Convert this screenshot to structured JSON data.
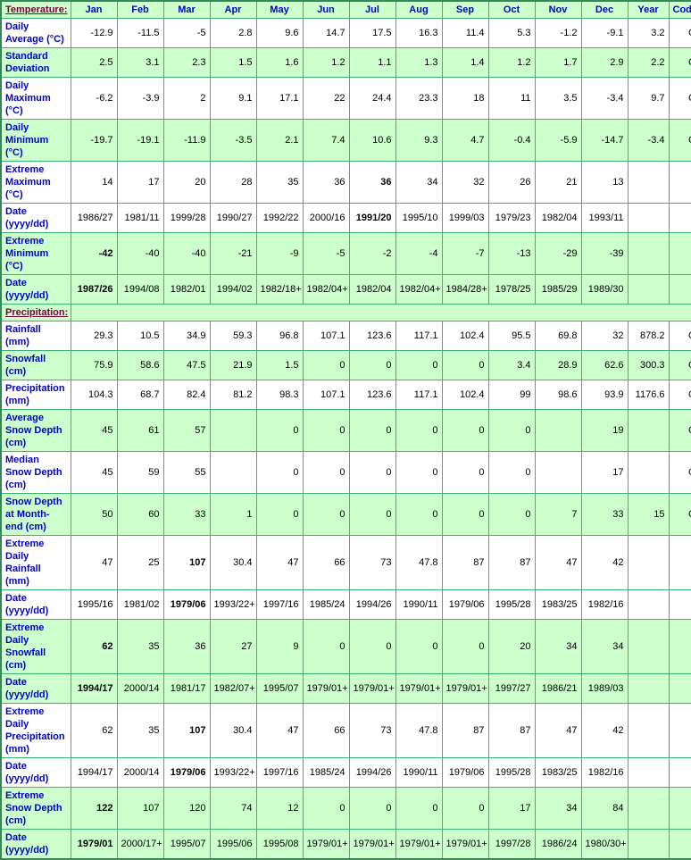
{
  "table": {
    "columns": [
      "Jan",
      "Feb",
      "Mar",
      "Apr",
      "May",
      "Jun",
      "Jul",
      "Aug",
      "Sep",
      "Oct",
      "Nov",
      "Dec",
      "Year",
      "Code"
    ],
    "sections": [
      {
        "id": "temperature",
        "title": "Temperature:",
        "rows": [
          {
            "label": "Daily Average (°C)",
            "shade": "plain",
            "cells": [
              "-12.9",
              "-11.5",
              "-5",
              "2.8",
              "9.6",
              "14.7",
              "17.5",
              "16.3",
              "11.4",
              "5.3",
              "-1.2",
              "-9.1",
              "3.2",
              "C"
            ],
            "bold": []
          },
          {
            "label": "Standard Deviation",
            "shade": "alt",
            "cells": [
              "2.5",
              "3.1",
              "2.3",
              "1.5",
              "1.6",
              "1.2",
              "1.1",
              "1.3",
              "1.4",
              "1.2",
              "1.7",
              "2.9",
              "2.2",
              "C"
            ],
            "bold": []
          },
          {
            "label": "Daily Maximum (°C)",
            "shade": "plain",
            "cells": [
              "-6.2",
              "-3.9",
              "2",
              "9.1",
              "17.1",
              "22",
              "24.4",
              "23.3",
              "18",
              "11",
              "3.5",
              "-3.4",
              "9.7",
              "C"
            ],
            "bold": []
          },
          {
            "label": "Daily Minimum (°C)",
            "shade": "alt",
            "cells": [
              "-19.7",
              "-19.1",
              "-11.9",
              "-3.5",
              "2.1",
              "7.4",
              "10.6",
              "9.3",
              "4.7",
              "-0.4",
              "-5.9",
              "-14.7",
              "-3.4",
              "C"
            ],
            "bold": []
          },
          {
            "label": "Extreme Maximum (°C)",
            "shade": "plain",
            "cells": [
              "14",
              "17",
              "20",
              "28",
              "35",
              "36",
              "36",
              "34",
              "32",
              "26",
              "21",
              "13",
              "",
              ""
            ],
            "bold": [
              6
            ]
          },
          {
            "label": "Date (yyyy/dd)",
            "shade": "plain",
            "cells": [
              "1986/27",
              "1981/11",
              "1999/28",
              "1990/27",
              "1992/22",
              "2000/16",
              "1991/20",
              "1995/10",
              "1999/03",
              "1979/23",
              "1982/04",
              "1993/11",
              "",
              ""
            ],
            "bold": [
              6
            ]
          },
          {
            "label": "Extreme Minimum (°C)",
            "shade": "alt",
            "cells": [
              "-42",
              "-40",
              "-40",
              "-21",
              "-9",
              "-5",
              "-2",
              "-4",
              "-7",
              "-13",
              "-29",
              "-39",
              "",
              ""
            ],
            "bold": [
              0
            ]
          },
          {
            "label": "Date (yyyy/dd)",
            "shade": "alt",
            "cells": [
              "1987/26",
              "1994/08",
              "1982/01",
              "1994/02",
              "1982/18+",
              "1982/04+",
              "1982/04",
              "1982/04+",
              "1984/28+",
              "1978/25",
              "1985/29",
              "1989/30",
              "",
              ""
            ],
            "bold": [
              0
            ]
          }
        ]
      },
      {
        "id": "precipitation",
        "title": "Precipitation:",
        "rows": [
          {
            "label": "Rainfall (mm)",
            "shade": "plain",
            "cells": [
              "29.3",
              "10.5",
              "34.9",
              "59.3",
              "96.8",
              "107.1",
              "123.6",
              "117.1",
              "102.4",
              "95.5",
              "69.8",
              "32",
              "878.2",
              "C"
            ],
            "bold": []
          },
          {
            "label": "Snowfall (cm)",
            "shade": "alt",
            "cells": [
              "75.9",
              "58.6",
              "47.5",
              "21.9",
              "1.5",
              "0",
              "0",
              "0",
              "0",
              "3.4",
              "28.9",
              "62.6",
              "300.3",
              "C"
            ],
            "bold": []
          },
          {
            "label": "Precipitation (mm)",
            "shade": "plain",
            "cells": [
              "104.3",
              "68.7",
              "82.4",
              "81.2",
              "98.3",
              "107.1",
              "123.6",
              "117.1",
              "102.4",
              "99",
              "98.6",
              "93.9",
              "1176.6",
              "C"
            ],
            "bold": []
          },
          {
            "label": "Average Snow Depth (cm)",
            "shade": "alt",
            "cells": [
              "45",
              "61",
              "57",
              "",
              "0",
              "0",
              "0",
              "0",
              "0",
              "0",
              "",
              "19",
              "",
              "C"
            ],
            "bold": []
          },
          {
            "label": "Median Snow Depth (cm)",
            "shade": "plain",
            "cells": [
              "45",
              "59",
              "55",
              "",
              "0",
              "0",
              "0",
              "0",
              "0",
              "0",
              "",
              "17",
              "",
              "C"
            ],
            "bold": []
          },
          {
            "label": "Snow Depth at Month-end (cm)",
            "shade": "alt",
            "cells": [
              "50",
              "60",
              "33",
              "1",
              "0",
              "0",
              "0",
              "0",
              "0",
              "0",
              "7",
              "33",
              "15",
              "C"
            ],
            "bold": []
          },
          {
            "label": "Extreme Daily Rainfall (mm)",
            "shade": "plain",
            "cells": [
              "47",
              "25",
              "107",
              "30.4",
              "47",
              "66",
              "73",
              "47.8",
              "87",
              "87",
              "47",
              "42",
              "",
              ""
            ],
            "bold": [
              2
            ]
          },
          {
            "label": "Date (yyyy/dd)",
            "shade": "plain",
            "cells": [
              "1995/16",
              "1981/02",
              "1979/06",
              "1993/22+",
              "1997/16",
              "1985/24",
              "1994/26",
              "1990/11",
              "1979/06",
              "1995/28",
              "1983/25",
              "1982/16",
              "",
              ""
            ],
            "bold": [
              2
            ]
          },
          {
            "label": "Extreme Daily Snowfall (cm)",
            "shade": "alt",
            "cells": [
              "62",
              "35",
              "36",
              "27",
              "9",
              "0",
              "0",
              "0",
              "0",
              "20",
              "34",
              "34",
              "",
              ""
            ],
            "bold": [
              0
            ]
          },
          {
            "label": "Date (yyyy/dd)",
            "shade": "alt",
            "cells": [
              "1994/17",
              "2000/14",
              "1981/17",
              "1982/07+",
              "1995/07",
              "1979/01+",
              "1979/01+",
              "1979/01+",
              "1979/01+",
              "1997/27",
              "1986/21",
              "1989/03",
              "",
              ""
            ],
            "bold": [
              0
            ]
          },
          {
            "label": "Extreme Daily Precipitation (mm)",
            "shade": "plain",
            "cells": [
              "62",
              "35",
              "107",
              "30.4",
              "47",
              "66",
              "73",
              "47.8",
              "87",
              "87",
              "47",
              "42",
              "",
              ""
            ],
            "bold": [
              2
            ]
          },
          {
            "label": "Date (yyyy/dd)",
            "shade": "plain",
            "cells": [
              "1994/17",
              "2000/14",
              "1979/06",
              "1993/22+",
              "1997/16",
              "1985/24",
              "1994/26",
              "1990/11",
              "1979/06",
              "1995/28",
              "1983/25",
              "1982/16",
              "",
              ""
            ],
            "bold": [
              2
            ]
          },
          {
            "label": "Extreme Snow Depth (cm)",
            "shade": "alt",
            "cells": [
              "122",
              "107",
              "120",
              "74",
              "12",
              "0",
              "0",
              "0",
              "0",
              "17",
              "34",
              "84",
              "",
              ""
            ],
            "bold": [
              0
            ]
          },
          {
            "label": "Date (yyyy/dd)",
            "shade": "alt",
            "cells": [
              "1979/01",
              "2000/17+",
              "1995/07",
              "1995/06",
              "1995/08",
              "1979/01+",
              "1979/01+",
              "1979/01+",
              "1979/01+",
              "1997/28",
              "1986/24",
              "1980/30+",
              "",
              ""
            ],
            "bold": [
              0
            ]
          }
        ]
      }
    ]
  },
  "colors": {
    "shade_green": "#ccffcc",
    "border_green": "#3cb371",
    "label_blue": "#0000cc",
    "section_maroon": "#800040"
  }
}
